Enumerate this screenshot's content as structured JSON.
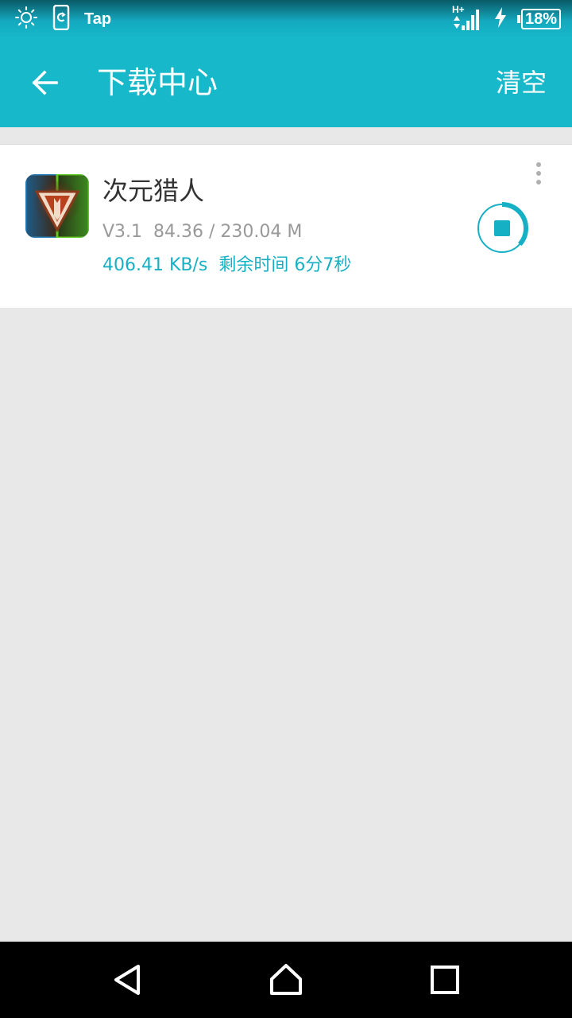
{
  "status_bar": {
    "left_icons": [
      "brightness-icon",
      "screenshot-icon"
    ],
    "app_label": "Tap",
    "network_type": "H+",
    "battery_percent": "18%"
  },
  "app_bar": {
    "back_icon": "arrow-left-icon",
    "title": "下载中心",
    "clear_label": "清空"
  },
  "downloads": [
    {
      "name": "次元猎人",
      "meta": "V3.1  84.36 / 230.04 M",
      "speed_line": "406.41 KB/s  剩余时间 6分7秒",
      "progress": 0.3667,
      "action_icon": "stop-icon",
      "menu_icon": "more-vert-icon"
    }
  ],
  "colors": {
    "accent": "#16b8c9",
    "speed_text": "#16b0c4",
    "meta_text": "#999999",
    "background": "#e8e8e8"
  },
  "nav_bar": {
    "icons": [
      "back-triangle-icon",
      "home-icon",
      "recents-icon"
    ]
  }
}
